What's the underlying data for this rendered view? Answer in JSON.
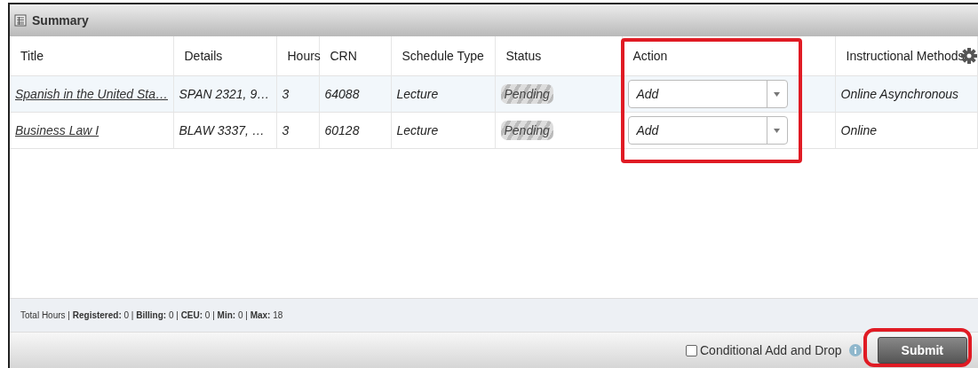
{
  "panel": {
    "title": "Summary"
  },
  "table": {
    "columns": [
      "Title",
      "Details",
      "Hours",
      "CRN",
      "Schedule Type",
      "Status",
      "Action",
      "Instructional Methods"
    ],
    "rows": [
      {
        "title": "Spanish in the United Sta…",
        "details": "SPAN 2321, 9…",
        "hours": "3",
        "crn": "64088",
        "schedule_type": "Lecture",
        "status": "Pending",
        "action": "Add",
        "instructional_methods": "Online Asynchronous",
        "selected": true
      },
      {
        "title": "Business Law I",
        "details": "BLAW 3337, …",
        "hours": "3",
        "crn": "60128",
        "schedule_type": "Lecture",
        "status": "Pending",
        "action": "Add",
        "instructional_methods": "Online",
        "selected": false
      }
    ]
  },
  "totals": "Total Hours | **Registered:** 0 | **Billing:** 0 | **CEU:** 0 | **Min:** 0 | **Max:** 18",
  "conditional_add_drop": {
    "label": "Conditional Add and Drop",
    "checked": false
  },
  "submit_button": "Submit"
}
